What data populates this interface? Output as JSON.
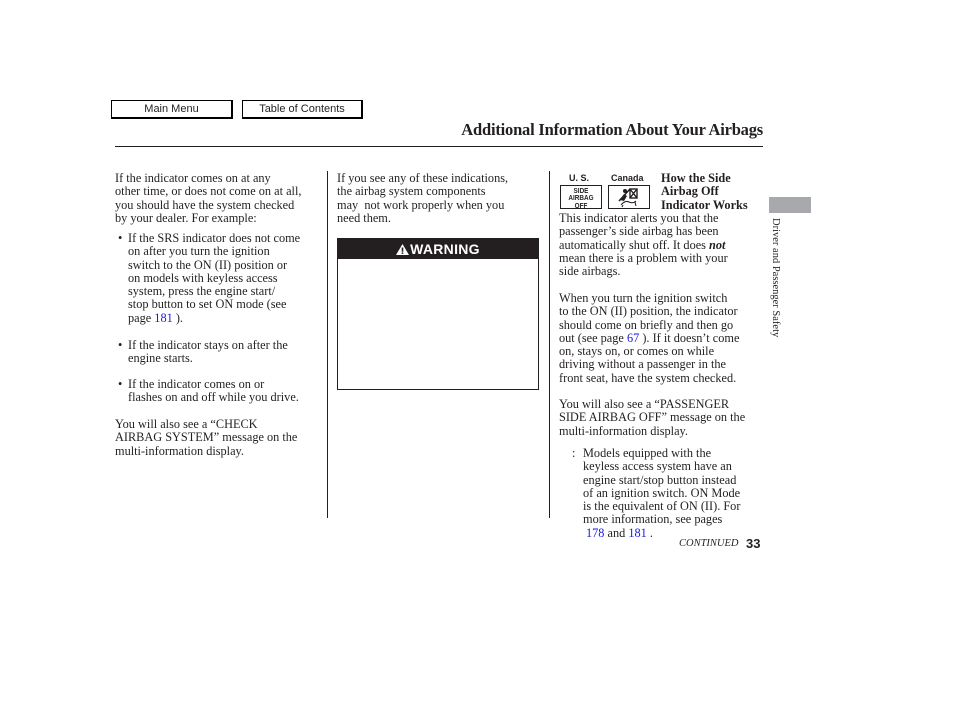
{
  "nav": {
    "main_menu": "Main Menu",
    "table_of_contents": "Table of Contents"
  },
  "header": {
    "title": "Additional Information About Your Airbags"
  },
  "col1": {
    "intro": [
      "If the indicator comes on at any",
      "other time, or does not come on at all,",
      "you should have the system checked",
      "by your dealer. For example:"
    ],
    "bullets": [
      {
        "lines": [
          "If the SRS indicator does not come",
          "on after you turn the ignition",
          "switch to the ON (II) position or",
          "on models with keyless access",
          "system, press the engine start/",
          "stop button to set ON mode (see"
        ],
        "last_prefix": "page ",
        "link": "181",
        "last_suffix": " )."
      },
      {
        "lines": [
          "If the indicator stays on after the",
          "engine starts."
        ]
      },
      {
        "lines": [
          "If the indicator comes on or",
          "flashes on and off while you drive."
        ]
      }
    ],
    "bullet_symbol": "•",
    "outro": [
      "You will also see a “CHECK",
      "AIRBAG SYSTEM” message on the",
      "multi-information display."
    ]
  },
  "col2": {
    "intro": [
      "If you see any of these indications,",
      "the airbag system components",
      "may  not work properly when you",
      "need them."
    ],
    "warning": {
      "icon": "warning-triangle-icon",
      "label": "WARNING"
    }
  },
  "col3": {
    "indicator": {
      "us_label": "U. S.",
      "canada_label": "Canada",
      "us_icon_text": [
        "SIDE",
        "AIRBAG",
        "OFF"
      ],
      "canada_icon": "side-airbag-off-symbol-icon"
    },
    "heading": [
      "How the Side",
      "Airbag Off",
      "Indicator Works"
    ],
    "para1": {
      "line1": "This indicator alerts you that the",
      "line2": "passenger’s side airbag has been",
      "line3_prefix": "automatically shut off. It does ",
      "line3_emph": "not",
      "line4": "mean there is a problem with your",
      "line5": "side airbags."
    },
    "para2": {
      "lines": [
        "When you turn the ignition switch",
        "to the ON (II) position, the indicator",
        "should come on briefly and then go"
      ],
      "link_prefix": "out (see page ",
      "link": "67",
      "link_suffix": " ). If it doesn’t come",
      "rest": [
        "on, stays on, or comes on while",
        "driving without a passenger in the",
        "front seat, have the system checked."
      ]
    },
    "para3": [
      "You will also see a “PASSENGER",
      "SIDE AIRBAG OFF” message on the",
      "multi-information display."
    ],
    "footnote": {
      "marker": ":",
      "lines": [
        "Models equipped with the",
        "keyless access system have an",
        "engine start/stop button instead",
        "of an ignition switch. ON Mode",
        "is the equivalent of ON (II). For",
        "more information, see pages"
      ],
      "link1": "178",
      "mid": " and ",
      "link2": "181",
      "end": " ."
    }
  },
  "footer": {
    "continued": "CONTINUED",
    "page_number": "33"
  },
  "side_tab": {
    "section": "Driver and Passenger Safety",
    "tab_color": "#a7a9ac"
  },
  "colors": {
    "link": "#1a1ae0",
    "text": "#231f20"
  }
}
